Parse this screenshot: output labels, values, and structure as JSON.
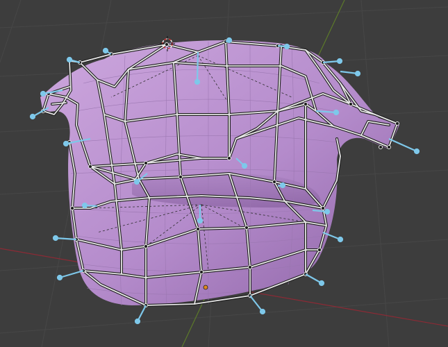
{
  "viewport": {
    "mode": "edit-mode-3d-viewport",
    "background": "#3d3d3d",
    "grid_color": "#4a4a4a",
    "x_axis_color": "#8c2a35",
    "y_axis_color": "#5c7a2a",
    "mesh_fill_light": "#c79ed9",
    "mesh_fill_dark": "#8e63a6",
    "cage_wire_color": "#1e1e1e",
    "cage_wire_highlight": "#e6e6e6",
    "normal_color": "#7ec8ea",
    "origin_color": "#e08a1e",
    "cursor_colors": [
      "#d03030",
      "#ffffff"
    ]
  },
  "objects": {
    "mesh_name": "",
    "cursor_label": "3d-cursor",
    "origin_label": "object-origin"
  }
}
